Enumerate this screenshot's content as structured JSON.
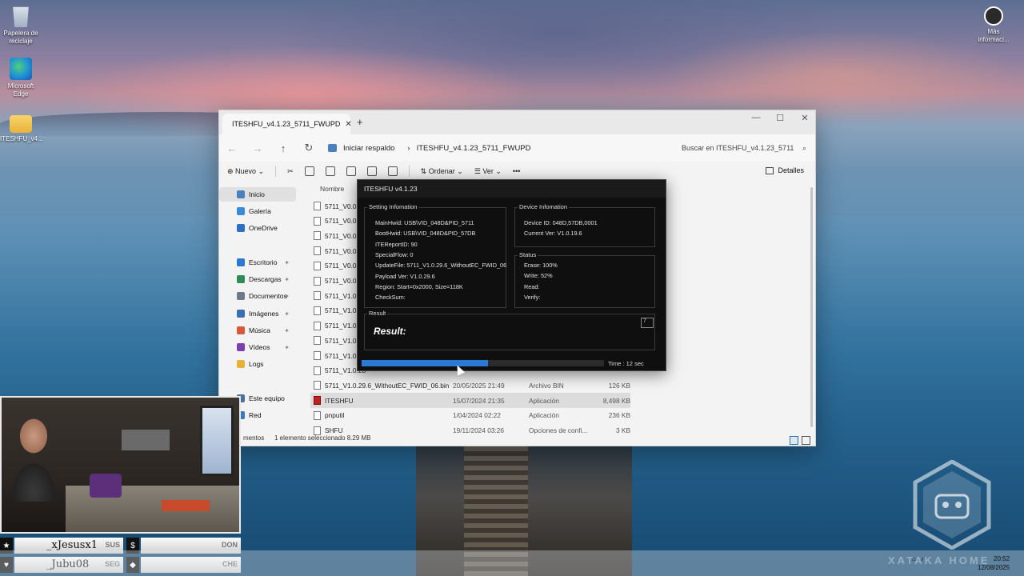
{
  "desktop": {
    "icons": [
      {
        "label": "Papelera de reciclaje",
        "icon": "recycle-bin-icon"
      },
      {
        "label": "Microsoft Edge",
        "icon": "edge-icon"
      },
      {
        "label": "ITESHFU_v4...",
        "icon": "folder-icon"
      }
    ],
    "top_right_icon": {
      "label": "Más informaci...",
      "icon": "info-icon"
    }
  },
  "explorer": {
    "tab_title": "ITESHFU_v4.1.23_5711_FWUPD",
    "new_tab": "+",
    "controls": {
      "minimize": "—",
      "maximize": "☐",
      "close": "✕"
    },
    "nav": {
      "back": "←",
      "forward": "→",
      "up": "↑",
      "refresh": "↻"
    },
    "address": {
      "home": "Iniciar respaldo",
      "separator": "›",
      "folder": "ITESHFU_v4.1.23_5711_FWUPD"
    },
    "search_placeholder": "Buscar en ITESHFU_v4.1.23_5711",
    "toolbar": {
      "new": "Nuevo",
      "sort": "Ordenar",
      "view": "Ver",
      "more": "•••",
      "details": "Detalles"
    },
    "sidebar": [
      {
        "label": "Inicio",
        "selected": true
      },
      {
        "label": "Galería"
      },
      {
        "label": "OneDrive"
      },
      {
        "label": "Escritorio",
        "pinned": true
      },
      {
        "label": "Descargas",
        "pinned": true
      },
      {
        "label": "Documentos",
        "pinned": true
      },
      {
        "label": "Imágenes",
        "pinned": true
      },
      {
        "label": "Música",
        "pinned": true
      },
      {
        "label": "Vídeos",
        "pinned": true
      },
      {
        "label": "Logs"
      },
      {
        "label": "Este equipo"
      },
      {
        "label": "Red"
      }
    ],
    "column_header": "Nombre",
    "files": [
      {
        "name": "5711_V0.0.8..",
        "date": "",
        "type": "",
        "size": ""
      },
      {
        "name": "5711_V0.0.31",
        "date": "",
        "type": "",
        "size": ""
      },
      {
        "name": "5711_V0.0.31",
        "date": "",
        "type": "",
        "size": ""
      },
      {
        "name": "5711_V0.0.32",
        "date": "",
        "type": "",
        "size": ""
      },
      {
        "name": "5711_V0.0.33",
        "date": "",
        "type": "",
        "size": ""
      },
      {
        "name": "5711_V0.0.33",
        "date": "",
        "type": "",
        "size": ""
      },
      {
        "name": "5711_V1.0.23",
        "date": "",
        "type": "",
        "size": ""
      },
      {
        "name": "5711_V1.0.25",
        "date": "",
        "type": "",
        "size": ""
      },
      {
        "name": "5711_V1.0.25",
        "date": "",
        "type": "",
        "size": ""
      },
      {
        "name": "5711_V1.0.25",
        "date": "",
        "type": "",
        "size": ""
      },
      {
        "name": "5711_V1.0.27",
        "date": "",
        "type": "",
        "size": ""
      },
      {
        "name": "5711_V1.0.28",
        "date": "",
        "type": "",
        "size": ""
      },
      {
        "name": "5711_V1.0.29.6_WithoutEC_FWID_06.bin",
        "date": "20/05/2025 21:49",
        "type": "Archivo BIN",
        "size": "126 KB"
      },
      {
        "name": "ITESHFU",
        "date": "15/07/2024 21:35",
        "type": "Aplicación",
        "size": "8,498 KB",
        "selected": true,
        "app": true
      },
      {
        "name": "pnputil",
        "date": "1/04/2024 02:22",
        "type": "Aplicación",
        "size": "236 KB"
      },
      {
        "name": "SHFU",
        "date": "19/11/2024 03:26",
        "type": "Opciones de confi...",
        "size": "3 KB"
      }
    ],
    "status": {
      "items": "mentos",
      "selected": "1 elemento seleccionado  8.29 MB"
    }
  },
  "iteshfu": {
    "title": "ITESHFU v4.1.23",
    "setting_group": "Setting Infomation",
    "settings": [
      "MainHwid: USB\\VID_048D&PID_5711",
      "BootHwid: USB\\VID_048D&PID_57DB",
      "ITEReportID: 90",
      "SpecialFlow: 0",
      "UpdateFile: 5711_V1.0.29.6_WithoutEC_FWID_06",
      "Payload Ver: V1.0.29.6",
      "Region: Start=0x2000, Size=118K",
      "CheckSum:"
    ],
    "device_group": "Device Infomation",
    "device": [
      "Device ID: 048D,57DB,0001",
      "Current Ver: V1.0.19.6"
    ],
    "status_group": "Status",
    "status": [
      "Erase: 100%",
      "Write: 52%",
      "Read:",
      "Verify:"
    ],
    "result_group": "Result",
    "result_label": "Result:",
    "result_box": "7",
    "progress": 0.52,
    "time": "Time : 12 sec"
  },
  "overlay": {
    "players": [
      {
        "symbol": "★",
        "name": "_xJesusx1",
        "tag": "SUS"
      },
      {
        "symbol": "♥",
        "name": "_Jubu08",
        "tag": "SEG"
      }
    ],
    "right": [
      {
        "symbol": "$",
        "tag": "DON"
      },
      {
        "symbol": "◆",
        "tag": "CHE"
      }
    ]
  },
  "watermark": "XATAKA HOME",
  "clock": {
    "time": "20:52",
    "date": "12/08/2025"
  }
}
